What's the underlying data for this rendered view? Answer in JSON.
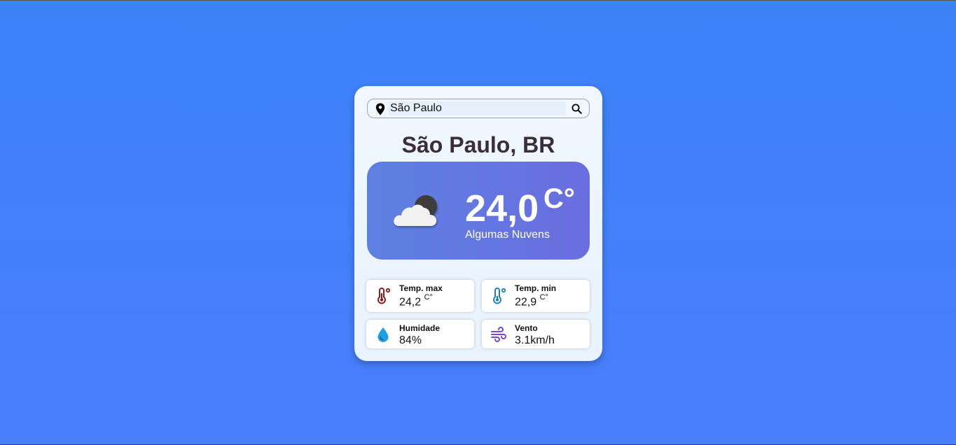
{
  "search": {
    "value": "São Paulo",
    "pin_icon": "map-pin-icon",
    "search_icon": "search-icon"
  },
  "location": {
    "city_label": "São Paulo, BR"
  },
  "current": {
    "temperature": "24,0",
    "unit": "C°",
    "description": "Algumas Nuvens",
    "icon": "cloud-moon-icon"
  },
  "details": {
    "temp_max": {
      "label": "Temp. max",
      "value": "24,2",
      "unit": "C°",
      "icon": "thermometer-hot-icon",
      "color": "#8b1a1a"
    },
    "temp_min": {
      "label": "Temp. min",
      "value": "22,9",
      "unit": "C°",
      "icon": "thermometer-cold-icon",
      "color": "#1f7fb8"
    },
    "humidity": {
      "label": "Humidade",
      "value": "84%",
      "icon": "water-drop-icon",
      "color": "#1ea0e6"
    },
    "wind": {
      "label": "Vento",
      "value": "3.1km/h",
      "icon": "wind-icon",
      "color": "#7a45d8"
    }
  },
  "colors": {
    "background": "#3f80f8",
    "card": "#eef6ff",
    "weather_box_start": "#5d81e2",
    "weather_box_end": "#6a6de0",
    "city_text": "#3a2e3a"
  }
}
